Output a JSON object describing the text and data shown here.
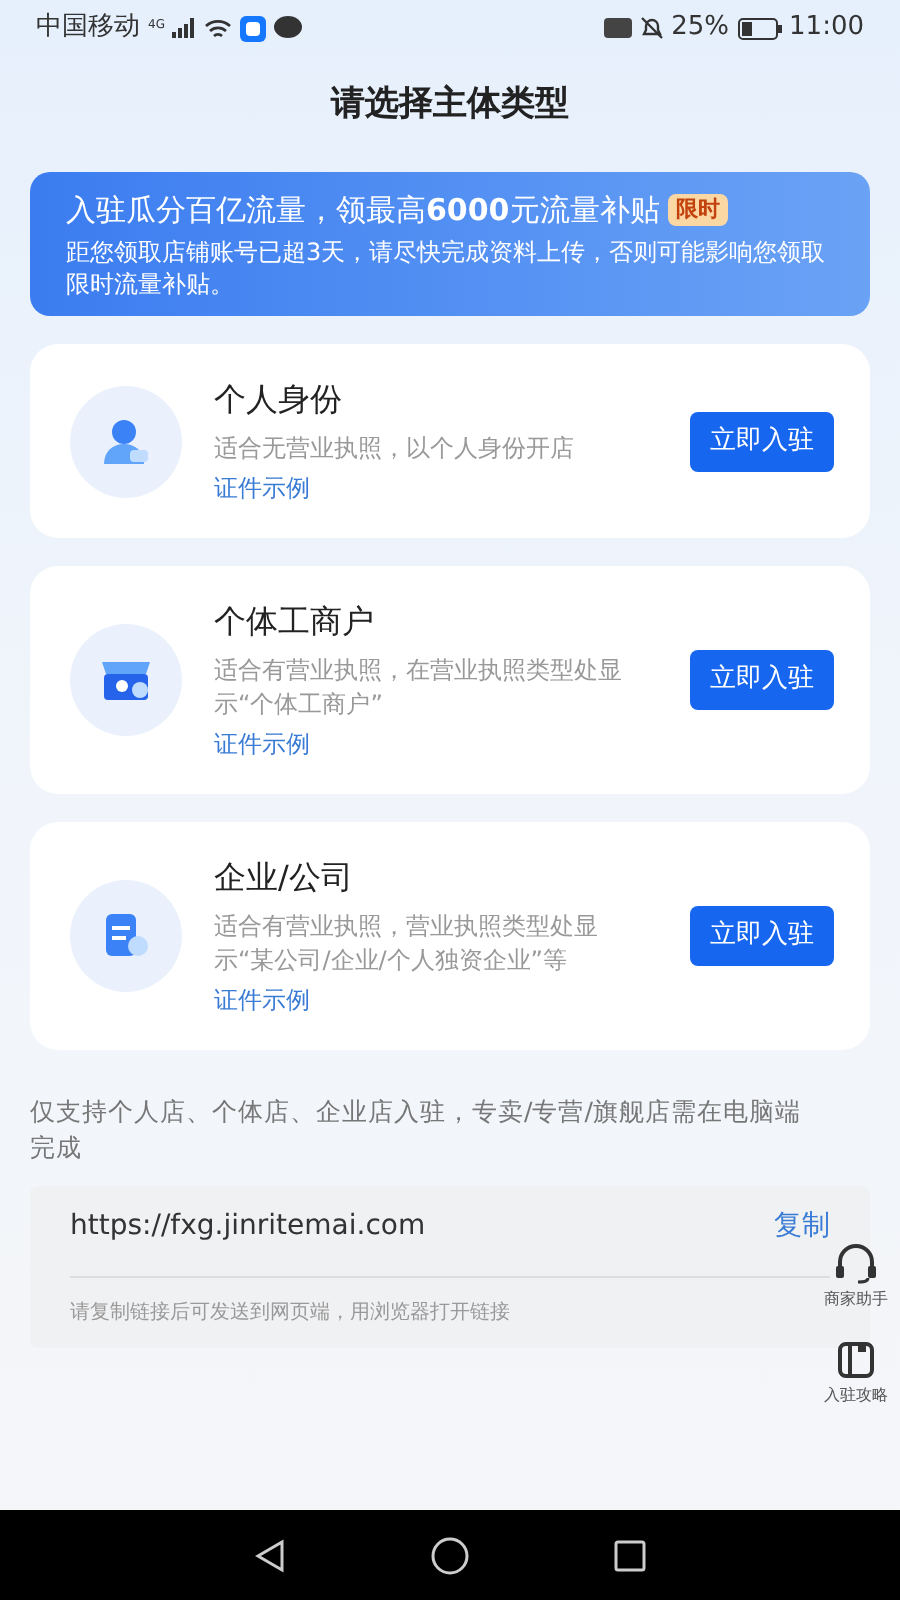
{
  "status_bar": {
    "carrier": "中国移动",
    "network": "4G",
    "battery": "25%",
    "time": "11:00"
  },
  "title": "请选择主体类型",
  "banner": {
    "headline": "入驻瓜分百亿流量，领最高**6000**元流量补贴",
    "tag": "限时",
    "message": "距您领取店铺账号已超3天，请尽快完成资料上传，否则可能影响您领取限时流量补贴。"
  },
  "options": [
    {
      "kind": "person",
      "title": "个人身份",
      "description": "适合无营业执照，以个人身份开店",
      "link": "证件示例",
      "button": "立即入驻"
    },
    {
      "kind": "store",
      "title": "个体工商户",
      "description": "适合有营业执照，在营业执照类型处显示“个体工商户”",
      "link": "证件示例",
      "button": "立即入驻"
    },
    {
      "kind": "company",
      "title": "企业/公司",
      "description": "适合有营业执照，营业执照类型处显示“某公司/企业/个人独资企业”等",
      "link": "证件示例",
      "button": "立即入驻"
    }
  ],
  "notice": "仅支持个人店、个体店、企业店入驻，专卖/专营/旗舰店需在电脑端完成",
  "link_box": {
    "url": "https://fxg.jinritemai.com",
    "copy": "复制",
    "hint": "请复制链接后可发送到网页端，用浏览器打开链接"
  },
  "floating": [
    {
      "kind": "headset",
      "label": "商家助手"
    },
    {
      "kind": "book",
      "label": "入驻攻略"
    }
  ]
}
